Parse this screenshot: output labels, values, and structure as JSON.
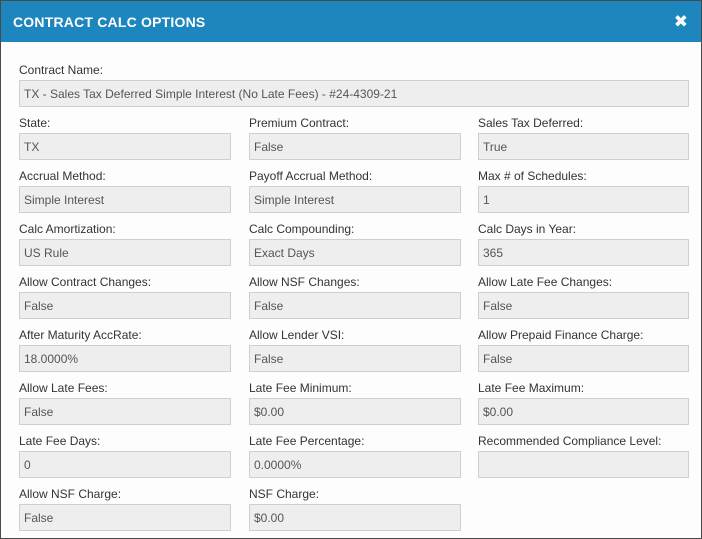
{
  "dialog": {
    "title": "CONTRACT CALC OPTIONS",
    "close_symbol": "✖",
    "close_icon": "close-icon"
  },
  "fields": [
    {
      "label": "Contract Name:",
      "value": "TX - Sales Tax Deferred Simple Interest (No Late Fees) - #24-4309-21"
    },
    {
      "label": "State:",
      "value": "TX"
    },
    {
      "label": "Premium Contract:",
      "value": "False"
    },
    {
      "label": "Sales Tax Deferred:",
      "value": "True"
    },
    {
      "label": "Accrual Method:",
      "value": "Simple Interest"
    },
    {
      "label": "Payoff Accrual Method:",
      "value": "Simple Interest"
    },
    {
      "label": "Max # of Schedules:",
      "value": "1"
    },
    {
      "label": "Calc Amortization:",
      "value": "US Rule"
    },
    {
      "label": "Calc Compounding:",
      "value": "Exact Days"
    },
    {
      "label": "Calc Days in Year:",
      "value": "365"
    },
    {
      "label": "Allow Contract Changes:",
      "value": "False"
    },
    {
      "label": "Allow NSF Changes:",
      "value": "False"
    },
    {
      "label": "Allow Late Fee Changes:",
      "value": "False"
    },
    {
      "label": "After Maturity AccRate:",
      "value": "18.0000%"
    },
    {
      "label": "Allow Lender VSI:",
      "value": "False"
    },
    {
      "label": "Allow Prepaid Finance Charge:",
      "value": "False"
    },
    {
      "label": "Allow Late Fees:",
      "value": "False"
    },
    {
      "label": "Late Fee Minimum:",
      "value": "$0.00"
    },
    {
      "label": "Late Fee Maximum:",
      "value": "$0.00"
    },
    {
      "label": "Late Fee Days:",
      "value": "0"
    },
    {
      "label": "Late Fee Percentage:",
      "value": "0.0000%"
    },
    {
      "label": "Recommended Compliance Level:",
      "value": ""
    },
    {
      "label": "Allow NSF Charge:",
      "value": "False"
    },
    {
      "label": "NSF Charge:",
      "value": "$0.00"
    }
  ],
  "colors": {
    "header_bg": "#1d86bf",
    "field_bg": "#eeeeee",
    "field_border": "#cfcfcf"
  }
}
